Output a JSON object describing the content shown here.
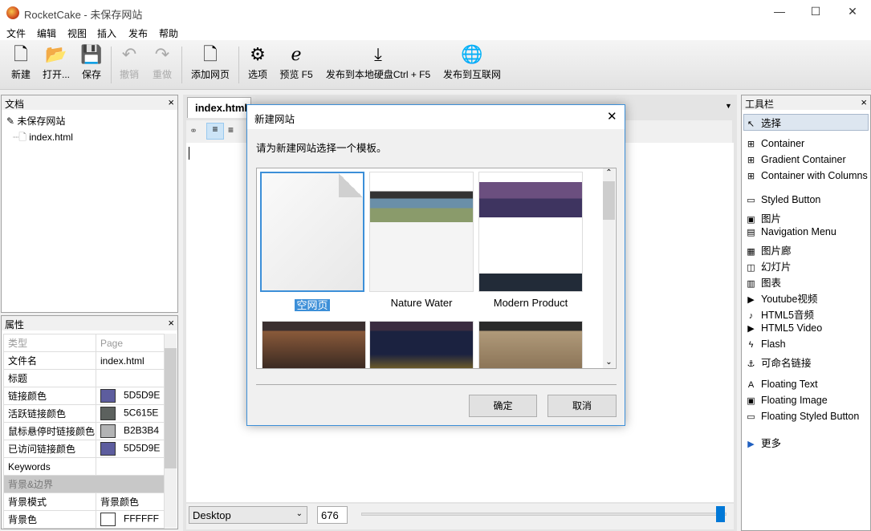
{
  "window": {
    "title": "RocketCake - 未保存网站",
    "minimize": "—",
    "maximize": "☐",
    "close": "✕"
  },
  "menu": [
    "文件",
    "编辑",
    "视图",
    "插入",
    "发布",
    "帮助"
  ],
  "toolbar": [
    {
      "label": "新建",
      "icon": "new-file-icon",
      "glyph": "🗋",
      "enabled": true
    },
    {
      "label": "打开...",
      "icon": "open-folder-icon",
      "glyph": "📂",
      "enabled": true
    },
    {
      "label": "保存",
      "icon": "save-icon",
      "glyph": "💾",
      "enabled": true
    },
    {
      "label": "撤销",
      "icon": "undo-icon",
      "glyph": "↶",
      "enabled": false
    },
    {
      "label": "重做",
      "icon": "redo-icon",
      "glyph": "↷",
      "enabled": false
    },
    {
      "label": "添加网页",
      "icon": "add-page-icon",
      "glyph": "🗋",
      "enabled": true
    },
    {
      "label": "选项",
      "icon": "gear-icon",
      "glyph": "⚙",
      "enabled": true
    },
    {
      "label": "预览 F5",
      "icon": "preview-browser-icon",
      "glyph": "ℯ",
      "enabled": true
    },
    {
      "label": "发布到本地硬盘Ctrl + F5",
      "icon": "download-icon",
      "glyph": "⤓",
      "enabled": true
    },
    {
      "label": "发布到互联网",
      "icon": "globe-icon",
      "glyph": "🌐",
      "enabled": true
    }
  ],
  "documents": {
    "title": "文档",
    "close": "×",
    "site": "未保存网站",
    "file": "index.html"
  },
  "properties": {
    "title": "属性",
    "close": "×",
    "rows": [
      {
        "key": "类型",
        "value": "Page",
        "dim": true
      },
      {
        "key": "文件名",
        "value": "index.html"
      },
      {
        "key": "标题",
        "value": ""
      },
      {
        "key": "链接颜色",
        "value": "5D5D9E",
        "color": "#5D5D9E"
      },
      {
        "key": "活跃链接颜色",
        "value": "5C615E",
        "color": "#5C615E"
      },
      {
        "key": "鼠标悬停时链接颜色",
        "value": "B2B3B4",
        "color": "#B2B3B4"
      },
      {
        "key": "已访问链接颜色",
        "value": "5D5D9E",
        "color": "#5D5D9E"
      },
      {
        "key": "Keywords",
        "value": ""
      },
      {
        "group": "背景&边界"
      },
      {
        "key": "背景模式",
        "value": "背景颜色"
      },
      {
        "key": "背景色",
        "value": "FFFFFF",
        "color": "#FFFFFF"
      }
    ]
  },
  "editor": {
    "tab": "index.html",
    "view_select": "Desktop",
    "width_value": "676",
    "slider_fraction": 0.99
  },
  "toolbox": {
    "title": "工具栏",
    "close": "×",
    "items": [
      {
        "label": "选择",
        "glyph": "↖",
        "selected": true
      },
      {
        "label": "Container",
        "glyph": "⊞"
      },
      {
        "label": "Gradient Container",
        "glyph": "⊞"
      },
      {
        "label": "Container with Columns",
        "glyph": "⊞"
      },
      {
        "label": "Styled Button",
        "glyph": "▭"
      },
      {
        "label": "图片",
        "glyph": "▣"
      },
      {
        "label": "Navigation Menu",
        "glyph": "▤"
      },
      {
        "label": "图片廊",
        "glyph": "▦"
      },
      {
        "label": "幻灯片",
        "glyph": "◫"
      },
      {
        "label": "图表",
        "glyph": "▥"
      },
      {
        "label": "Youtube视频",
        "glyph": "▶"
      },
      {
        "label": "HTML5音频",
        "glyph": "♪"
      },
      {
        "label": "HTML5 Video",
        "glyph": "▶"
      },
      {
        "label": "Flash",
        "glyph": "ϟ"
      },
      {
        "label": "可命名链接",
        "glyph": "⚓"
      },
      {
        "label": "Floating Text",
        "glyph": "A"
      },
      {
        "label": "Floating Image",
        "glyph": "▣"
      },
      {
        "label": "Floating Styled Button",
        "glyph": "▭"
      },
      {
        "label": "更多",
        "glyph": "▶"
      }
    ]
  },
  "dialog": {
    "title": "新建网站",
    "close": "✕",
    "instruction": "请为新建网站选择一个模板。",
    "templates": [
      {
        "label": "空网页",
        "selected": true
      },
      {
        "label": "Nature Water"
      },
      {
        "label": "Modern Product"
      },
      {
        "label": ""
      },
      {
        "label": ""
      },
      {
        "label": ""
      }
    ],
    "ok": "确定",
    "cancel": "取消"
  }
}
